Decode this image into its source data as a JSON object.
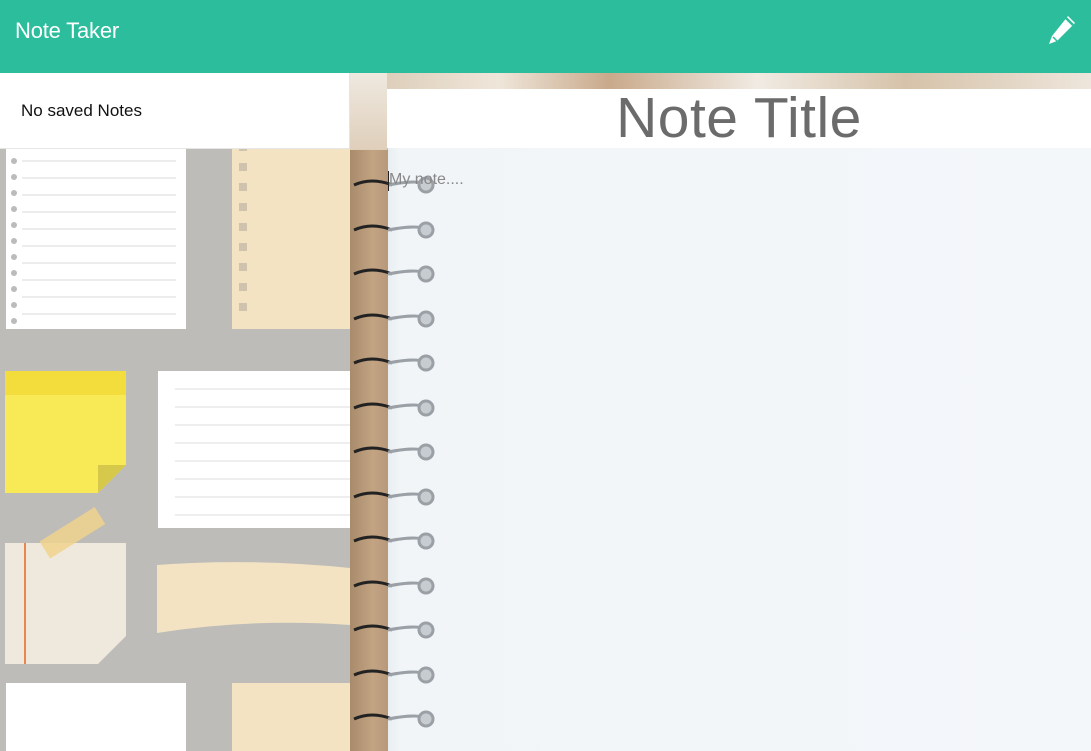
{
  "app": {
    "title": "Note Taker"
  },
  "header": {
    "new_note_icon": "pencil-icon"
  },
  "sidebar": {
    "empty_message": "No saved Notes"
  },
  "editor": {
    "title_value": "Note Title",
    "body_placeholder": "My note...."
  },
  "colors": {
    "navbar": "#2bbd9c",
    "title_text": "#6b6b6b"
  }
}
